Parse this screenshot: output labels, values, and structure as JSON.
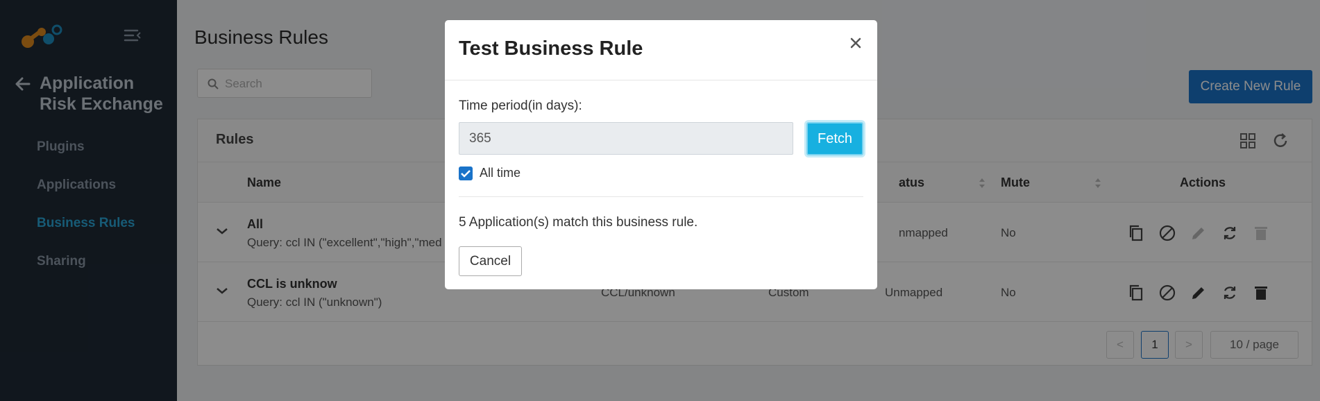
{
  "sidebar": {
    "app_title": "Application Risk Exchange",
    "items": [
      {
        "label": "Plugins"
      },
      {
        "label": "Applications"
      },
      {
        "label": "Business Rules"
      },
      {
        "label": "Sharing"
      }
    ],
    "active_item": "Business Rules"
  },
  "header": {
    "title": "Business Rules",
    "search_placeholder": "Search",
    "create_button": "Create New Rule"
  },
  "card": {
    "title": "Rules",
    "columns": {
      "name": "Name",
      "status": "atus",
      "mute": "Mute",
      "actions": "Actions"
    },
    "rows": [
      {
        "name": "All",
        "query": "Query: ccl IN (\"excellent\",\"high\",\"med",
        "status": "nmapped",
        "mute": "No"
      },
      {
        "name": "CCL is unknow",
        "query": "Query: ccl IN (\"unknown\")",
        "tag": "CCL/unknown",
        "type": "Custom",
        "status": "Unmapped",
        "mute": "No"
      }
    ],
    "pagination": {
      "current_page": "1",
      "prev": "<",
      "next": ">",
      "page_size": "10 / page"
    }
  },
  "modal": {
    "title": "Test Business Rule",
    "close": "×",
    "time_period_label": "Time period(in days):",
    "time_period_value": "365",
    "fetch_button": "Fetch",
    "all_time_label": "All time",
    "all_time_checked": true,
    "match_text": "5 Application(s) match this business rule.",
    "cancel_button": "Cancel"
  },
  "colors": {
    "sidebar_bg": "#1f2a36",
    "active_nav": "#2aa6d8",
    "primary": "#1a73c9",
    "fetch": "#17b0e0"
  }
}
